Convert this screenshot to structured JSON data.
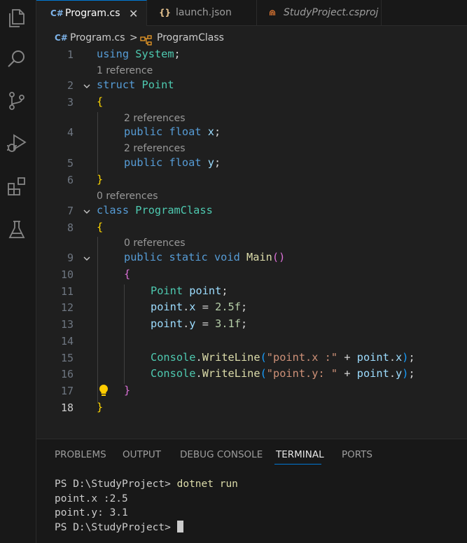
{
  "tabs": [
    {
      "icon": "C#",
      "label": "Program.cs",
      "close": "✕"
    },
    {
      "icon": "{}",
      "label": "launch.json"
    },
    {
      "icon": "⋒",
      "label": "StudyProject.csproj"
    }
  ],
  "breadcrumb": {
    "file_icon": "C#",
    "file": "Program.cs",
    "separator": ">",
    "symbol": "ProgramClass"
  },
  "line_numbers": [
    "1",
    "2",
    "3",
    "4",
    "5",
    "6",
    "7",
    "8",
    "9",
    "10",
    "11",
    "12",
    "13",
    "14",
    "15",
    "16",
    "17",
    "18"
  ],
  "code_lens": {
    "struct_point": "1 reference",
    "field_x": "2 references",
    "field_y": "2 references",
    "program_class": "0 references",
    "main": "0 references"
  },
  "code": {
    "l1": [
      "using",
      "System",
      ";"
    ],
    "l2": [
      "struct",
      "Point"
    ],
    "l3": "{",
    "l4": [
      "public",
      "float",
      "x",
      ";"
    ],
    "l5": [
      "public",
      "float",
      "y",
      ";"
    ],
    "l6": "}",
    "l7": [
      "class",
      "ProgramClass"
    ],
    "l8": "{",
    "l9": [
      "public",
      "static",
      "void",
      "Main",
      "()"
    ],
    "l10": "{",
    "l11": [
      "Point",
      "point",
      ";"
    ],
    "l12": [
      "point",
      ".",
      "x",
      " = ",
      "2.5f",
      ";"
    ],
    "l13": [
      "point",
      ".",
      "y",
      " = ",
      "3.1f",
      ";"
    ],
    "l15": [
      "Console",
      ".",
      "WriteLine",
      "(",
      "\"point.x :\"",
      " + ",
      "point",
      ".",
      "x",
      ")",
      ";"
    ],
    "l16": [
      "Console",
      ".",
      "WriteLine",
      "(",
      "\"point.y: \"",
      " + ",
      "point",
      ".",
      "y",
      ")",
      ";"
    ],
    "l17": "}",
    "l18": "}"
  },
  "panel": {
    "tabs": [
      "PROBLEMS",
      "OUTPUT",
      "DEBUG CONSOLE",
      "TERMINAL",
      "PORTS"
    ],
    "active_tab": "TERMINAL"
  },
  "terminal": {
    "prompt": "PS D:\\StudyProject> ",
    "command": "dotnet run",
    "output": [
      "point.x :2.5",
      "point.y: 3.1"
    ],
    "prompt2": "PS D:\\StudyProject> "
  },
  "colors": {
    "accent": "#0078d4",
    "csharp_icon": "#7eb4ea",
    "json_icon": "#e2c08d",
    "csproj_icon": "#e37933"
  }
}
